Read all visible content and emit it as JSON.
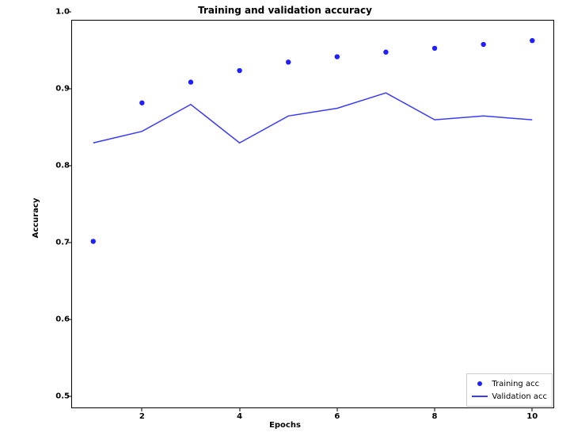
{
  "chart_data": {
    "type": "scatter+line",
    "title": "Training and validation accuracy",
    "xlabel": "Epochs",
    "ylabel": "Accuracy",
    "xlim": [
      0.55,
      10.45
    ],
    "ylim": [
      0.485,
      0.99
    ],
    "xticks": [
      2,
      4,
      6,
      8,
      10
    ],
    "yticks": [
      0.5,
      0.6,
      0.7,
      0.8,
      0.9,
      1.0
    ],
    "x": [
      1,
      2,
      3,
      4,
      5,
      6,
      7,
      8,
      9,
      10
    ],
    "series": [
      {
        "name": "Training acc",
        "style": "scatter",
        "color": "#1f1fff",
        "values": [
          0.702,
          0.882,
          0.909,
          0.924,
          0.935,
          0.942,
          0.948,
          0.953,
          0.958,
          0.963
        ]
      },
      {
        "name": "Validation acc",
        "style": "line",
        "color": "#3b3bff",
        "values": [
          0.83,
          0.845,
          0.88,
          0.83,
          0.865,
          0.875,
          0.895,
          0.86,
          0.865,
          0.86
        ]
      }
    ],
    "legend": {
      "position": "lower right",
      "items": [
        "Training acc",
        "Validation acc"
      ]
    }
  }
}
